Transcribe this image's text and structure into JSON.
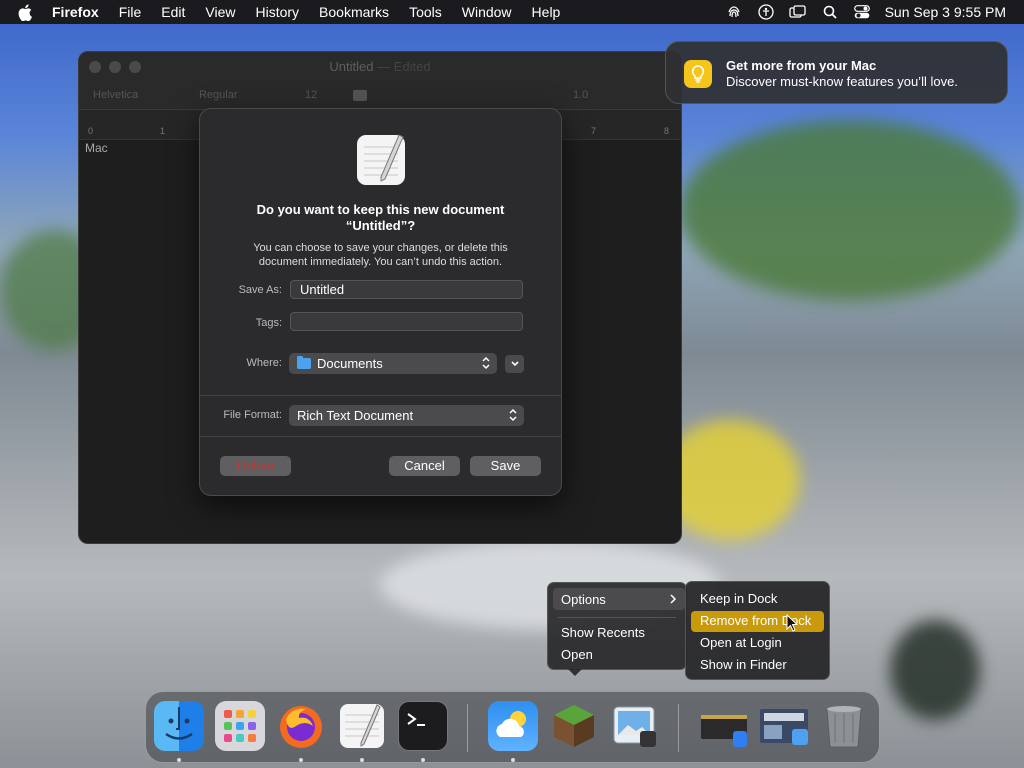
{
  "menubar": {
    "app_name": "Firefox",
    "items": [
      "File",
      "Edit",
      "View",
      "History",
      "Bookmarks",
      "Tools",
      "Window",
      "Help"
    ],
    "clock": "Sun Sep 3  9:55 PM"
  },
  "textedit": {
    "title": "Untitled",
    "title_suffix": "— Edited",
    "font_name": "Helvetica",
    "font_style": "Regular",
    "font_size": "12",
    "line_spacing": "1.0",
    "ruler_marks": [
      "0",
      "1",
      "7",
      "8"
    ],
    "body_text": "Mac"
  },
  "save_sheet": {
    "heading_line1": "Do you want to keep this new document",
    "heading_line2": "“Untitled”?",
    "description_line1": "You can choose to save your changes, or delete this",
    "description_line2": "document immediately. You can’t undo this action.",
    "save_as_label": "Save As:",
    "save_as_value": "Untitled",
    "tags_label": "Tags:",
    "where_label": "Where:",
    "where_value": "Documents",
    "format_label": "File Format:",
    "format_value": "Rich Text Document",
    "delete_label": "Delete",
    "cancel_label": "Cancel",
    "save_label": "Save"
  },
  "notification": {
    "title": "Get more from your Mac",
    "body": "Discover must-know features you’ll love."
  },
  "dock_menu": {
    "items": [
      "Options",
      "Show Recents",
      "Open"
    ],
    "submenu": [
      "Keep in Dock",
      "Remove from Dock",
      "Open at Login",
      "Show in Finder"
    ],
    "selected_submenu_item": "Remove from Dock"
  },
  "dock": {
    "apps": [
      "finder",
      "launchpad",
      "firefox",
      "textedit",
      "terminal",
      "weather",
      "minecraft",
      "preview"
    ],
    "running": [
      "finder",
      "firefox",
      "textedit",
      "terminal",
      "weather"
    ]
  },
  "colors": {
    "highlight": "#c99a0a",
    "delete_text": "#c23a32",
    "tip_icon": "#f5c51a"
  }
}
